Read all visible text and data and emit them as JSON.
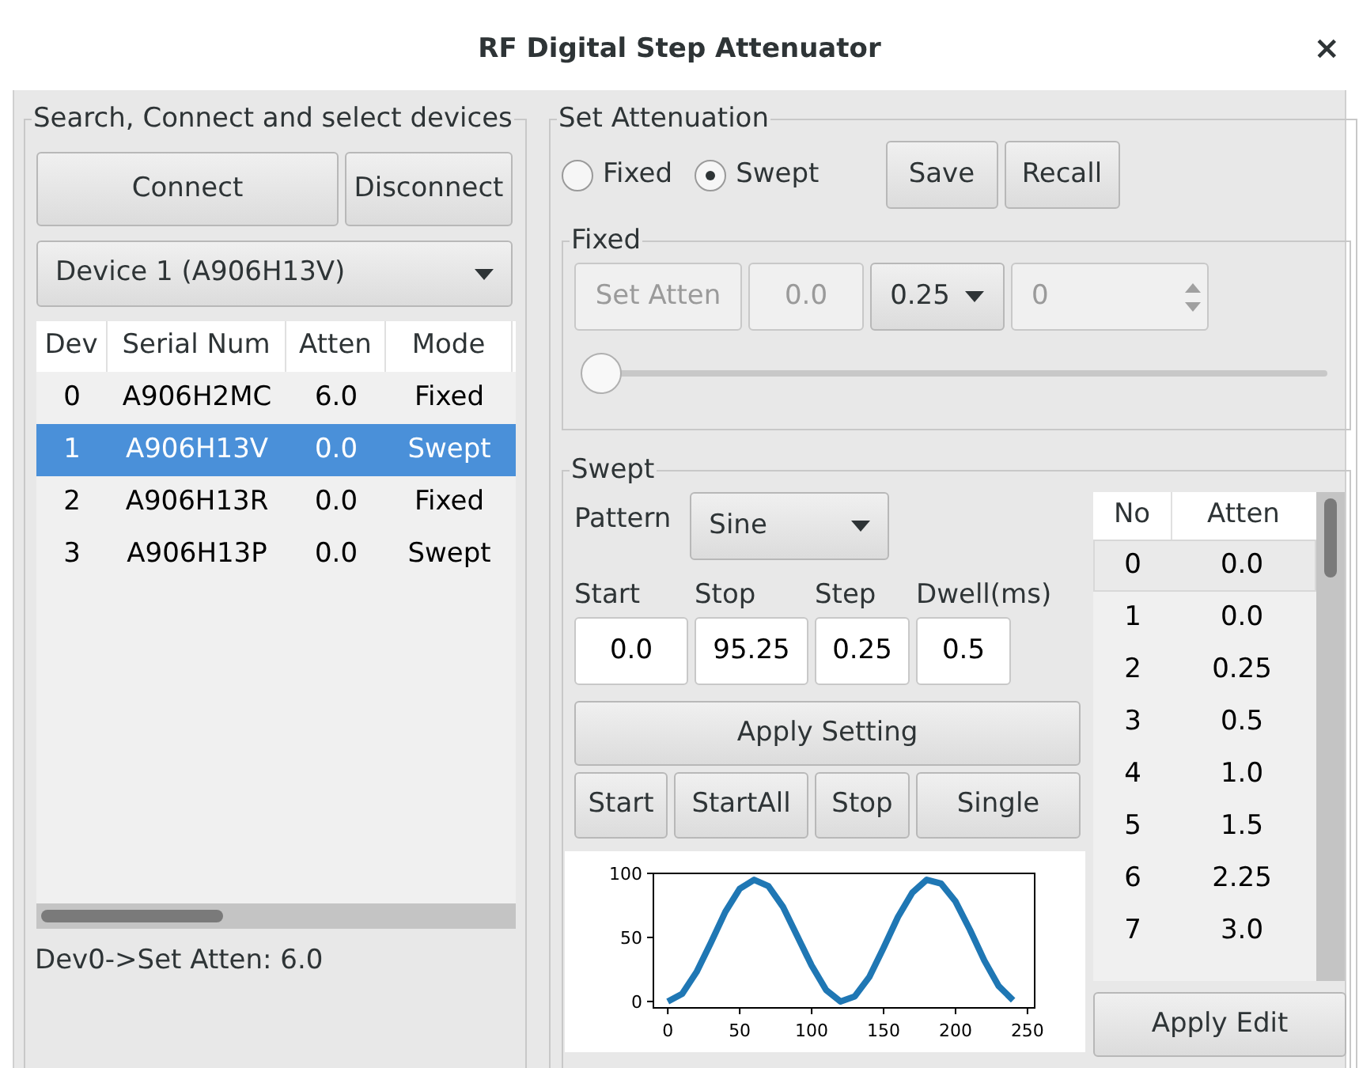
{
  "window": {
    "title": "RF Digital Step Attenuator",
    "close": "×"
  },
  "devices": {
    "legend": "Search, Connect and select devices",
    "buttons": [
      "Connect",
      "Disconnect"
    ],
    "device_select": "Device 1 (A906H13V)",
    "table": {
      "columns": [
        "Dev",
        "Serial Num",
        "Atten",
        "Mode"
      ],
      "rows": [
        {
          "cells": [
            "0",
            "A906H2MC",
            "6.0",
            "Fixed"
          ],
          "selected": false
        },
        {
          "cells": [
            "1",
            "A906H13V",
            "0.0",
            "Swept"
          ],
          "selected": true
        },
        {
          "cells": [
            "2",
            "A906H13R",
            "0.0",
            "Fixed"
          ],
          "selected": false
        },
        {
          "cells": [
            "3",
            "A906H13P",
            "0.0",
            "Swept"
          ],
          "selected": false
        }
      ]
    },
    "status": "Dev0->Set Atten: 6.0"
  },
  "attenuation": {
    "legend": "Set Attenuation",
    "modes": [
      {
        "label": "Fixed",
        "selected": false
      },
      {
        "label": "Swept",
        "selected": true
      }
    ],
    "buttons": [
      "Save",
      "Recall"
    ],
    "fixed": {
      "legend": "Fixed",
      "disabled": true,
      "set_button": "Set Atten",
      "value": "0.0",
      "step_select": "0.25",
      "spin_value": "0",
      "slider": {
        "level": 0
      }
    },
    "swept": {
      "legend": "Swept",
      "pattern_label": "Pattern",
      "pattern_select": "Sine",
      "params": [
        {
          "label": "Start",
          "value": "0.0"
        },
        {
          "label": "Stop",
          "value": "95.25"
        },
        {
          "label": "Step",
          "value": "0.25"
        },
        {
          "label": "Dwell(ms)",
          "value": "0.5"
        }
      ],
      "apply_button": "Apply Setting",
      "run_buttons": [
        "Start",
        "StartAll",
        "Stop",
        "Single"
      ],
      "chart_data": {
        "type": "line",
        "x": [
          0,
          10,
          20,
          30,
          40,
          50,
          60,
          70,
          80,
          90,
          100,
          110,
          120,
          130,
          140,
          150,
          160,
          170,
          180,
          190,
          200,
          210,
          220,
          230,
          240
        ],
        "series": [
          {
            "color": "#1f77b4",
            "values": [
              0,
              6,
              23,
              46,
              70,
              88,
              95,
              90,
              74,
              51,
              28,
              9,
              0,
              4,
              19,
              42,
              66,
              85,
              95,
              92,
              78,
              56,
              32,
              12,
              1
            ]
          }
        ],
        "xlim": [
          -10,
          255
        ],
        "ylim": [
          -5,
          100
        ],
        "xticks": [
          0,
          50,
          100,
          150,
          200,
          250
        ],
        "yticks": [
          0,
          50,
          100
        ]
      },
      "table": {
        "columns": [
          "No",
          "Atten"
        ],
        "rows": [
          {
            "cells": [
              "0",
              "0.0"
            ],
            "selected": true
          },
          {
            "cells": [
              "1",
              "0.0"
            ],
            "selected": false
          },
          {
            "cells": [
              "2",
              "0.25"
            ],
            "selected": false
          },
          {
            "cells": [
              "3",
              "0.5"
            ],
            "selected": false
          },
          {
            "cells": [
              "4",
              "1.0"
            ],
            "selected": false
          },
          {
            "cells": [
              "5",
              "1.5"
            ],
            "selected": false
          },
          {
            "cells": [
              "6",
              "2.25"
            ],
            "selected": false
          },
          {
            "cells": [
              "7",
              "3.0"
            ],
            "selected": false
          }
        ]
      },
      "edit_button": "Apply Edit"
    }
  }
}
